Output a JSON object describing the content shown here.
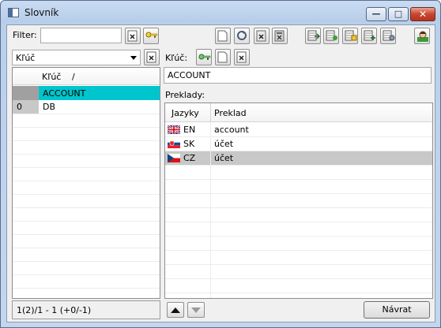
{
  "window": {
    "title": "Slovník"
  },
  "filter": {
    "label": "Filter:",
    "value": ""
  },
  "key_selector": {
    "selected": "Kľúč"
  },
  "left_grid": {
    "column_header": "Kľúč",
    "sort_indicator": "/",
    "rows": [
      {
        "index": "",
        "key": "ACCOUNT",
        "selected": true
      },
      {
        "index": "0",
        "key": "DB",
        "selected": false
      }
    ]
  },
  "status_bar": {
    "text": "1(2)/1  -  1 (+0/-1)"
  },
  "right_panel": {
    "key_label": "Kľúč:",
    "key_value": "ACCOUNT",
    "translations_label": "Preklady:",
    "columns": [
      "Jazyky",
      "Preklad"
    ],
    "rows": [
      {
        "flag": "gb-flag-icon",
        "lang": "EN",
        "translation": "account",
        "selected": false
      },
      {
        "flag": "sk-flag-icon",
        "lang": "SK",
        "translation": "účet",
        "selected": false
      },
      {
        "flag": "cz-flag-icon",
        "lang": "CZ",
        "translation": "účet",
        "selected": true
      }
    ]
  },
  "footer": {
    "back_button": "Návrat"
  },
  "colors": {
    "selection": "#00c5cc",
    "row_selected_gray": "#c8c8c8",
    "title_bar": "#c9dcf3"
  }
}
